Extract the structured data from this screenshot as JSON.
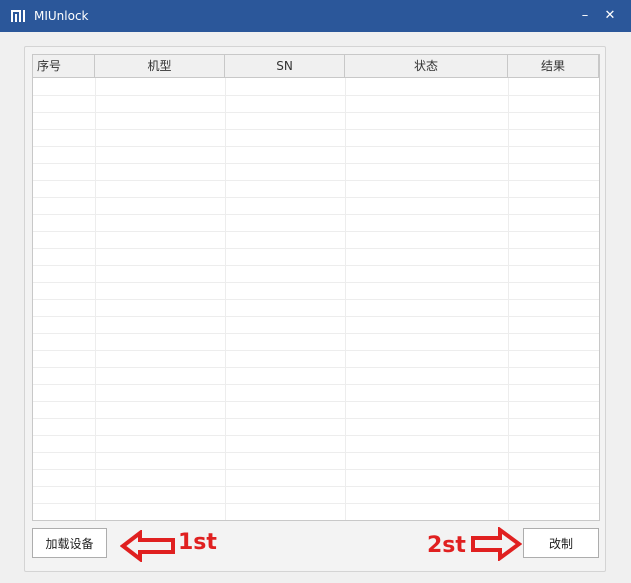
{
  "window": {
    "title": "MIUnlock",
    "minimize_glyph": "–",
    "close_glyph": "✕",
    "logo_icon": "mi-logo-icon"
  },
  "table": {
    "columns": [
      "序号",
      "机型",
      "SN",
      "状态",
      "结果"
    ],
    "rows": []
  },
  "buttons": {
    "load_label": "加载设备",
    "flash_label": "改制"
  },
  "annotations": {
    "step1": "1st",
    "step2": "2st",
    "color": "#e02020"
  },
  "colors": {
    "titlebar": "#2b579a",
    "background": "#f0f0f0"
  }
}
